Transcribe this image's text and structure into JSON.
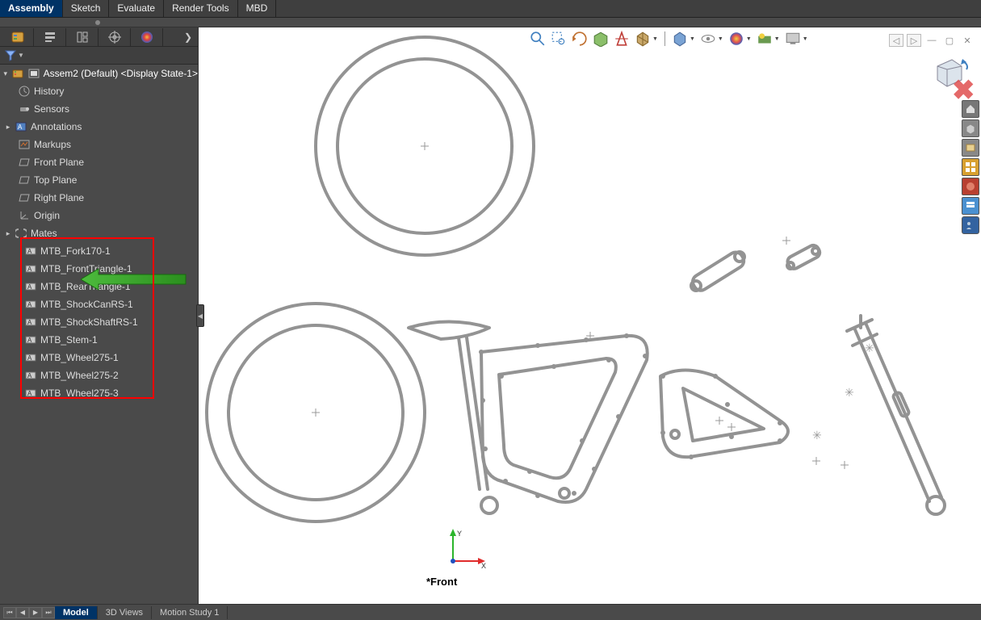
{
  "top_tabs": {
    "active": "Assembly",
    "items": [
      "Assembly",
      "Sketch",
      "Evaluate",
      "Render Tools",
      "MBD"
    ]
  },
  "tree": {
    "root": "Assem2 (Default) <Display State-1>",
    "nodes": [
      {
        "label": "History",
        "icon": "clock"
      },
      {
        "label": "Sensors",
        "icon": "sensor"
      },
      {
        "label": "Annotations",
        "icon": "annot",
        "expandable": true
      },
      {
        "label": "Markups",
        "icon": "markup"
      },
      {
        "label": "Front Plane",
        "icon": "plane"
      },
      {
        "label": "Top Plane",
        "icon": "plane"
      },
      {
        "label": "Right Plane",
        "icon": "plane"
      },
      {
        "label": "Origin",
        "icon": "origin"
      },
      {
        "label": "Mates",
        "icon": "mates",
        "expandable": true
      }
    ],
    "blocks": [
      "MTB_Fork170-1",
      "MTB_FrontTriangle-1",
      "MTB_RearTriangle-1",
      "MTB_ShockCanRS-1",
      "MTB_ShockShaftRS-1",
      "MTB_Stem-1",
      "MTB_Wheel275-1",
      "MTB_Wheel275-2",
      "MTB_Wheel275-3"
    ]
  },
  "bottom_tabs": {
    "active": "Model",
    "items": [
      "Model",
      "3D Views",
      "Motion Study 1"
    ]
  },
  "view_label": "*Front",
  "triad": {
    "y": "Y",
    "x": "X"
  }
}
